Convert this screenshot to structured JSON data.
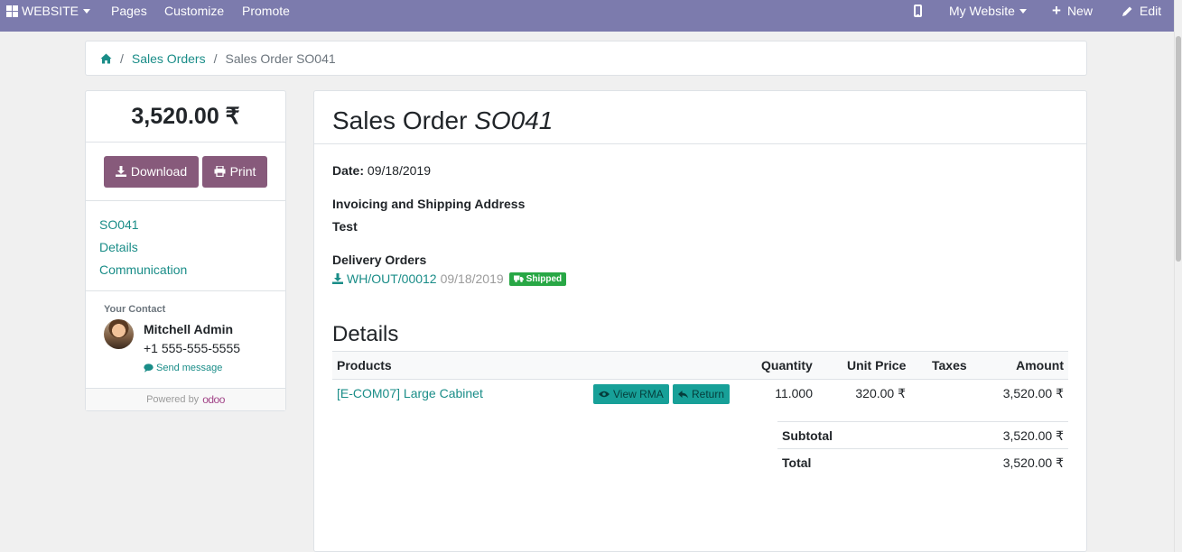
{
  "topbar": {
    "website_label": "WEBSITE",
    "pages_label": "Pages",
    "customize_label": "Customize",
    "promote_label": "Promote",
    "my_website_label": "My Website",
    "new_label": "New",
    "edit_label": "Edit"
  },
  "breadcrumb": {
    "sales_orders": "Sales Orders",
    "current": "Sales Order SO041"
  },
  "sidebar": {
    "amount": "3,520.00 ₹",
    "download_label": "Download",
    "print_label": "Print",
    "links": [
      "SO041",
      "Details",
      "Communication"
    ],
    "contact_label": "Your Contact",
    "contact_name": "Mitchell Admin",
    "contact_phone": "+1 555-555-5555",
    "send_message": "Send message",
    "powered_by": "Powered by",
    "odoo": "odoo"
  },
  "order": {
    "title_prefix": "Sales Order",
    "title_ref": "SO041",
    "date_label": "Date:",
    "date_value": "09/18/2019",
    "address_title": "Invoicing and Shipping Address",
    "address_name": "Test",
    "delivery_title": "Delivery Orders",
    "delivery_ref": "WH/OUT/00012",
    "delivery_date": "09/18/2019",
    "delivery_status": "Shipped",
    "details_title": "Details"
  },
  "table": {
    "headers": {
      "products": "Products",
      "quantity": "Quantity",
      "unit_price": "Unit Price",
      "taxes": "Taxes",
      "amount": "Amount"
    },
    "rows": [
      {
        "product": "[E-COM07] Large Cabinet",
        "view_rma": "View RMA",
        "return": "Return",
        "quantity": "11.000",
        "unit_price": "320.00 ₹",
        "taxes": "",
        "amount": "3,520.00 ₹"
      }
    ]
  },
  "totals": {
    "subtotal_label": "Subtotal",
    "subtotal_value": "3,520.00 ₹",
    "total_label": "Total",
    "total_value": "3,520.00 ₹"
  },
  "colors": {
    "topbar": "#7c7bad",
    "link": "#1a8d88",
    "primary_button": "#875a7b",
    "rma_button": "#17a098",
    "badge": "#28a745"
  }
}
